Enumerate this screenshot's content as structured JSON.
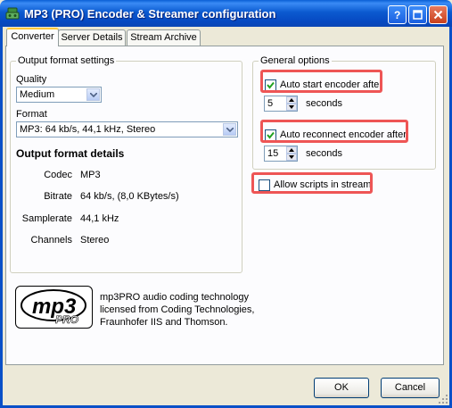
{
  "window": {
    "title": "MP3 (PRO) Encoder & Streamer configuration"
  },
  "tabs": [
    {
      "label": "Converter",
      "active": true
    },
    {
      "label": "Server Details",
      "active": false
    },
    {
      "label": "Stream Archive",
      "active": false
    }
  ],
  "output_format": {
    "group_title": "Output format settings",
    "quality_label": "Quality",
    "quality_value": "Medium",
    "format_label": "Format",
    "format_value": "MP3: 64 kb/s, 44,1 kHz, Stereo",
    "details_title": "Output format details",
    "details": [
      {
        "label": "Codec",
        "value": "MP3"
      },
      {
        "label": "Bitrate",
        "value": "64 kb/s, (8,0 KBytes/s)"
      },
      {
        "label": "Samplerate",
        "value": "44,1 kHz"
      },
      {
        "label": "Channels",
        "value": "Stereo"
      }
    ]
  },
  "general_options": {
    "group_title": "General options",
    "auto_start_label": "Auto start encoder after",
    "auto_start_checked": true,
    "auto_start_seconds": "5",
    "auto_reconnect_label": "Auto reconnect encoder after",
    "auto_reconnect_checked": true,
    "auto_reconnect_seconds": "15",
    "seconds_label": "seconds",
    "allow_scripts_label": "Allow scripts in stream",
    "allow_scripts_checked": false
  },
  "logo": {
    "text_main": "mp3",
    "text_sub": "PRO"
  },
  "info_lines": [
    "mp3PRO audio coding technology",
    "licensed from Coding Technologies,",
    "Fraunhofer IIS and Thomson."
  ],
  "buttons": {
    "ok_label": "OK",
    "cancel_label": "Cancel"
  },
  "colors": {
    "titlebar": "#0A5FD4",
    "highlight": "#EE5555",
    "tab_active_accent": "#FFC83C",
    "window_bg": "#ECE9D8"
  }
}
